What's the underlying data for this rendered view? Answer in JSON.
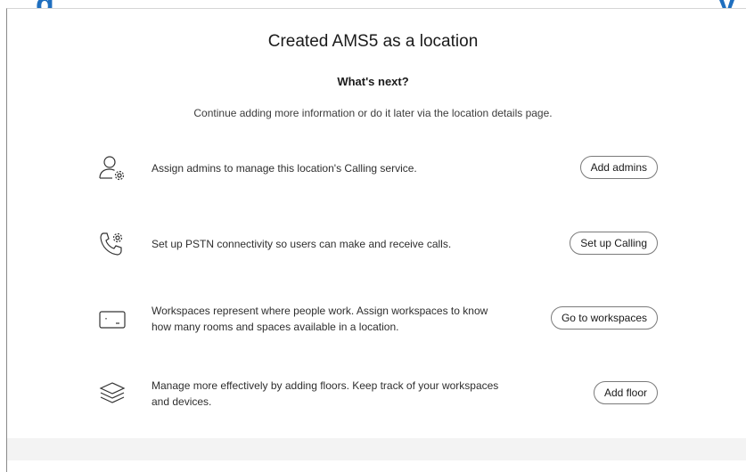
{
  "dialog": {
    "title": "Created AMS5 as a location",
    "subtitle": "What's next?",
    "description": "Continue adding more information or do it later via the location details page."
  },
  "actions": [
    {
      "icon": "user-gear-icon",
      "text": "Assign admins to manage this location's Calling service.",
      "button": "Add admins"
    },
    {
      "icon": "phone-gear-icon",
      "text": "Set up PSTN connectivity so users can make and receive calls.",
      "button": "Set up Calling"
    },
    {
      "icon": "workspace-icon",
      "text": "Workspaces represent where people work. Assign workspaces to know how many rooms and spaces available in a location.",
      "button": "Go to workspaces"
    },
    {
      "icon": "layers-icon",
      "text": "Manage more effectively by adding floors. Keep track of your workspaces and devices.",
      "button": "Add floor"
    }
  ],
  "colors": {
    "accent_background_text": "#1f6fbf",
    "button_border": "#7a7a7a",
    "footer": "#f3f3f3"
  }
}
